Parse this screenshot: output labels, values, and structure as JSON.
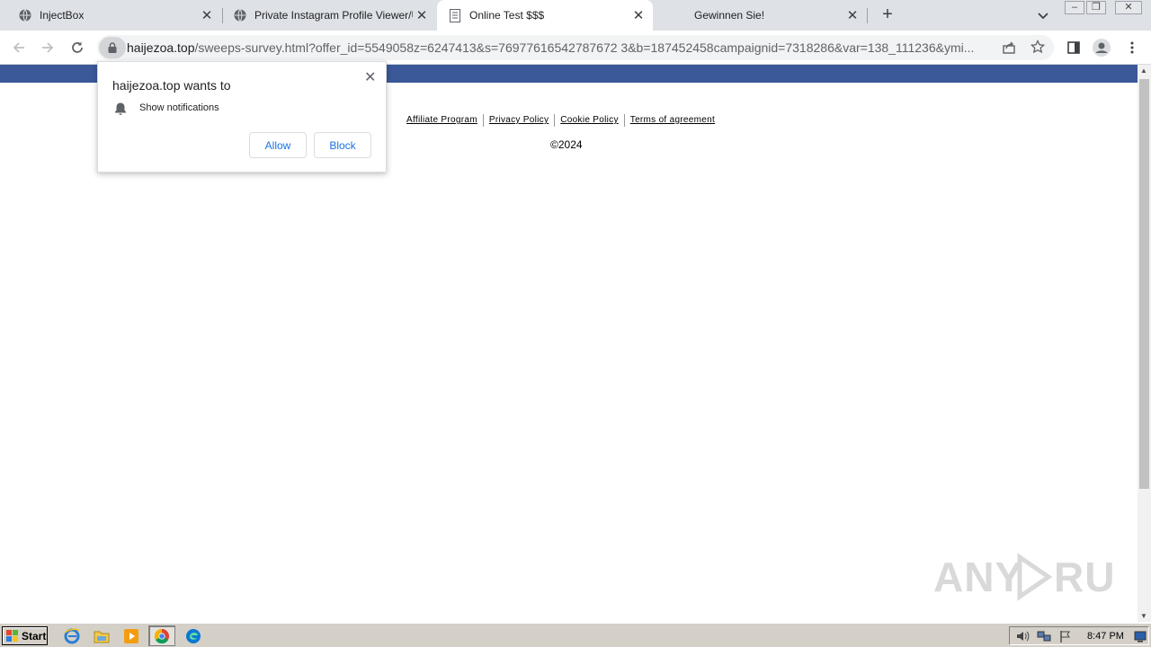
{
  "browser": {
    "tabs": [
      {
        "title": "InjectBox",
        "icon": "globe-icon",
        "active": false
      },
      {
        "title": "Private Instagram Profile Viewer/Unl",
        "icon": "globe-icon",
        "active": false
      },
      {
        "title": "Online Test $$$",
        "icon": "document-icon",
        "active": true
      },
      {
        "title": "Gewinnen Sie!",
        "icon": "none",
        "active": false
      }
    ],
    "new_tab_label": "+",
    "url_host": "haijezoa.top",
    "url_path": "/sweeps-survey.html?offer_id=5549058z=6247413&s=76977616542787672 3&b=187452458campaignid=7318286&var=138_111236&ymi...",
    "accent_color": "#3b5998"
  },
  "permission_prompt": {
    "title": "haijezoa.top wants to",
    "message": "Show notifications",
    "allow_label": "Allow",
    "block_label": "Block",
    "close_label": "✕"
  },
  "page": {
    "footer_links": [
      "Affiliate Program",
      "Privacy Policy",
      "Cookie Policy",
      "Terms of agreement"
    ],
    "copyright": "©2024"
  },
  "watermark": "ANY RUN",
  "taskbar": {
    "start_label": "Start",
    "clock": "8:47 PM"
  }
}
